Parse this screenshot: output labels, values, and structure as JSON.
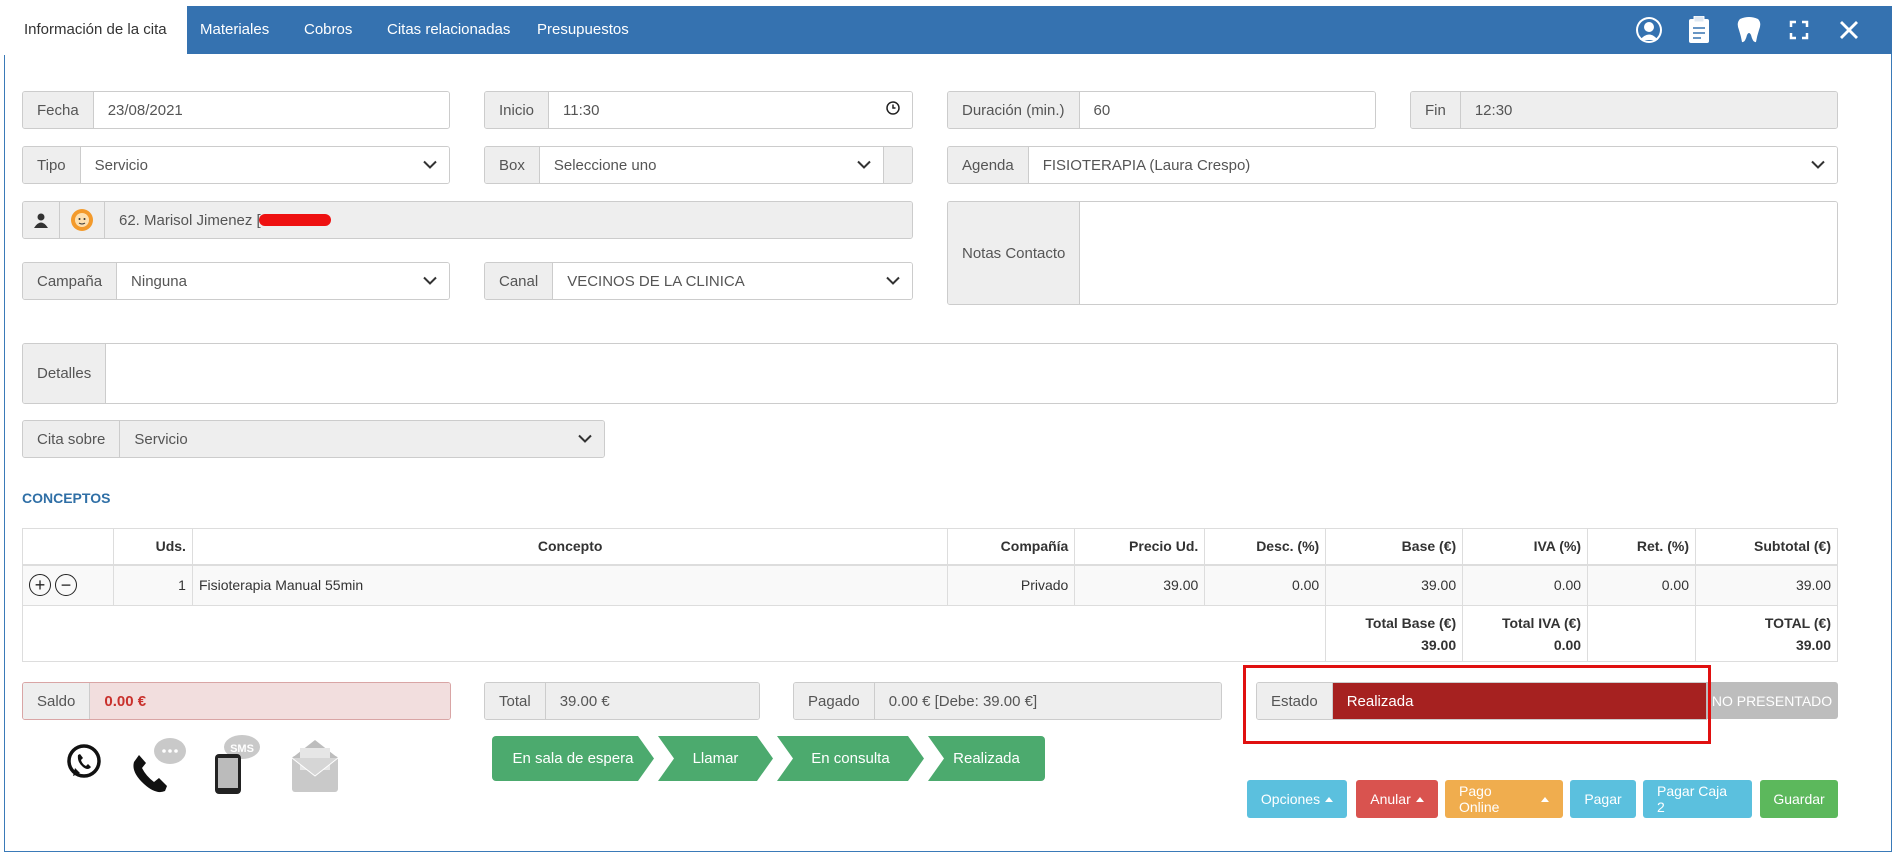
{
  "tabs": [
    {
      "label": "Información de la cita",
      "active": true
    },
    {
      "label": "Materiales",
      "active": false
    },
    {
      "label": "Cobros",
      "active": false
    },
    {
      "label": "Citas relacionadas",
      "active": false
    },
    {
      "label": "Presupuestos",
      "active": false
    }
  ],
  "header_icons": [
    "user-icon",
    "clipboard-icon",
    "tooth-icon",
    "fullscreen-icon",
    "close-icon"
  ],
  "form": {
    "fecha": {
      "label": "Fecha",
      "value": "23/08/2021"
    },
    "inicio": {
      "label": "Inicio",
      "value": "11:30"
    },
    "duracion": {
      "label": "Duración (min.)",
      "value": "60"
    },
    "fin": {
      "label": "Fin",
      "value": "12:30"
    },
    "tipo": {
      "label": "Tipo",
      "value": "Servicio"
    },
    "box": {
      "label": "Box",
      "value": "Seleccione uno"
    },
    "agenda": {
      "label": "Agenda",
      "value": "FISIOTERAPIA (Laura Crespo)"
    },
    "paciente": {
      "value": "62. Marisol Jimenez ["
    },
    "notas": {
      "label": "Notas Contacto",
      "value": ""
    },
    "campana": {
      "label": "Campaña",
      "value": "Ninguna"
    },
    "canal": {
      "label": "Canal",
      "value": "VECINOS DE LA CLINICA"
    },
    "detalles": {
      "label": "Detalles",
      "value": ""
    },
    "cita_sobre": {
      "label": "Cita sobre",
      "value": "Servicio"
    }
  },
  "conceptos": {
    "title": "CONCEPTOS",
    "headers": [
      "",
      "Uds.",
      "Concepto",
      "Compañía",
      "Precio Ud.",
      "Desc. (%)",
      "Base (€)",
      "IVA (%)",
      "Ret. (%)",
      "Subtotal (€)"
    ],
    "rows": [
      {
        "uds": "1",
        "concepto": "Fisioterapia Manual 55min",
        "compania": "Privado",
        "precio": "39.00",
        "desc": "0.00",
        "base": "39.00",
        "iva": "0.00",
        "ret": "0.00",
        "subtotal": "39.00"
      }
    ],
    "totals": {
      "base_label": "Total Base (€)",
      "base_value": "39.00",
      "iva_label": "Total IVA (€)",
      "iva_value": "0.00",
      "total_label": "TOTAL (€)",
      "total_value": "39.00"
    }
  },
  "summary": {
    "saldo": {
      "label": "Saldo",
      "value": "0.00 €"
    },
    "total": {
      "label": "Total",
      "value": "39.00 €"
    },
    "pagado": {
      "label": "Pagado",
      "value": "0.00 € [Debe: 39.00 €]"
    },
    "estado": {
      "label": "Estado",
      "value": "Realizada"
    },
    "no_presentado": "NO PRESENTADO"
  },
  "contact_icons": [
    "whatsapp-icon",
    "phone-icon",
    "sms-icon",
    "email-icon"
  ],
  "sms_label": "SMS",
  "flow": [
    "En sala de espera",
    "Llamar",
    "En consulta",
    "Realizada"
  ],
  "buttons": {
    "opciones": "Opciones",
    "anular": "Anular",
    "pago_online": "Pago Online",
    "pagar": "Pagar",
    "pagar_caja": "Pagar Caja 2",
    "guardar": "Guardar"
  },
  "colors": {
    "header": "#3572b0",
    "estado": "#a62120",
    "flow": "#4caa6e",
    "info": "#5bc0de",
    "danger": "#d9534f",
    "warning": "#f0ad4e",
    "success": "#5cb85c",
    "saldo_bg": "#f2dede",
    "saldo_text": "#c9302c"
  }
}
